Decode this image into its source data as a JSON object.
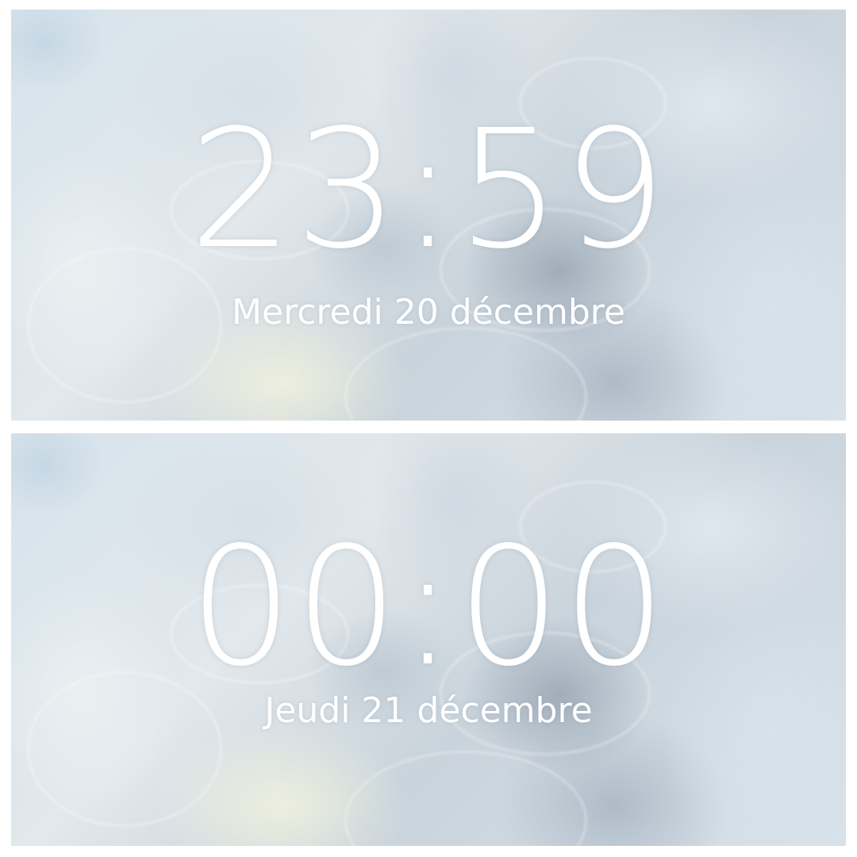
{
  "lockscreens": [
    {
      "time": "23:59",
      "date": "Mercredi 20 décembre"
    },
    {
      "time": "00:00",
      "date": "Jeudi 21 décembre"
    }
  ],
  "colors": {
    "text": "#ffffff",
    "border": "#ffffff",
    "wallpaper_base": "#d6e3ec"
  }
}
